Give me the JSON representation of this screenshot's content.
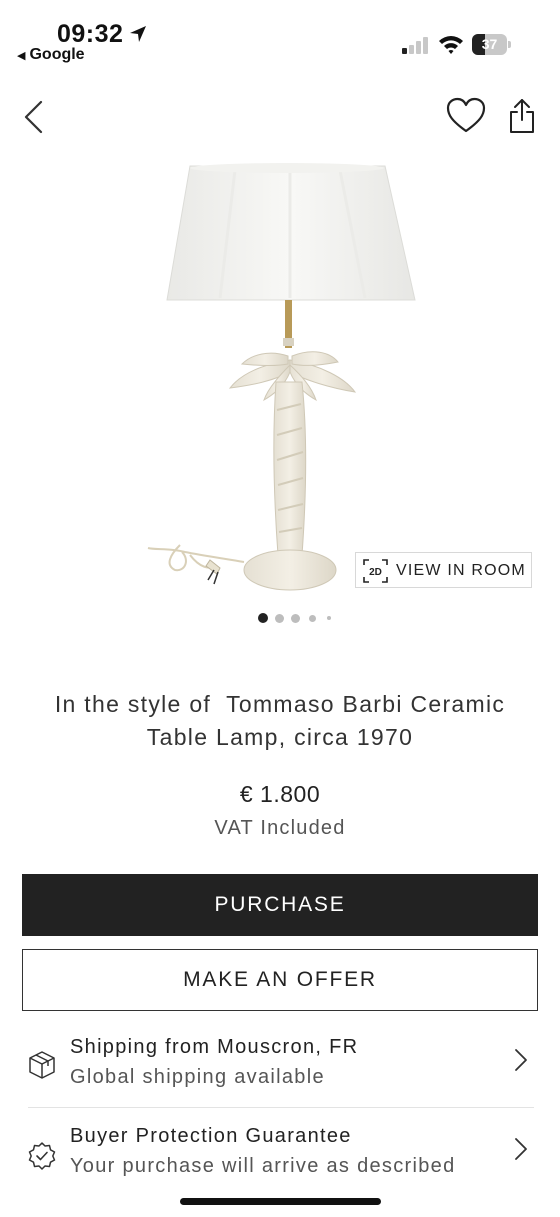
{
  "status_bar": {
    "time": "09:32",
    "back_app": "Google",
    "battery_percent": "37",
    "battery_level": 0.37,
    "signal_bars_active": 1
  },
  "nav": {
    "back_icon": "chevron-left-icon",
    "favorite_icon": "heart-icon",
    "share_icon": "share-icon"
  },
  "gallery": {
    "view_in_room_icon": "2D",
    "view_in_room_label": "VIEW IN ROOM",
    "pages_total": 5,
    "current_page": 1
  },
  "product": {
    "title_line1": "In the style of  Tommaso Barbi Ceramic",
    "title_line2": "Table Lamp, circa 1970",
    "price": "€ 1.800",
    "vat_note": "VAT Included"
  },
  "actions": {
    "purchase_label": "PURCHASE",
    "offer_label": "MAKE AN OFFER"
  },
  "info": {
    "shipping_title": "Shipping from Mouscron, FR",
    "shipping_sub": "Global shipping available",
    "protection_title": "Buyer Protection Guarantee",
    "protection_sub": "Your purchase will arrive as described"
  },
  "colors": {
    "primary_button": "#222222",
    "text": "#222222",
    "muted_text": "#555555",
    "border": "#d8d8d8"
  }
}
